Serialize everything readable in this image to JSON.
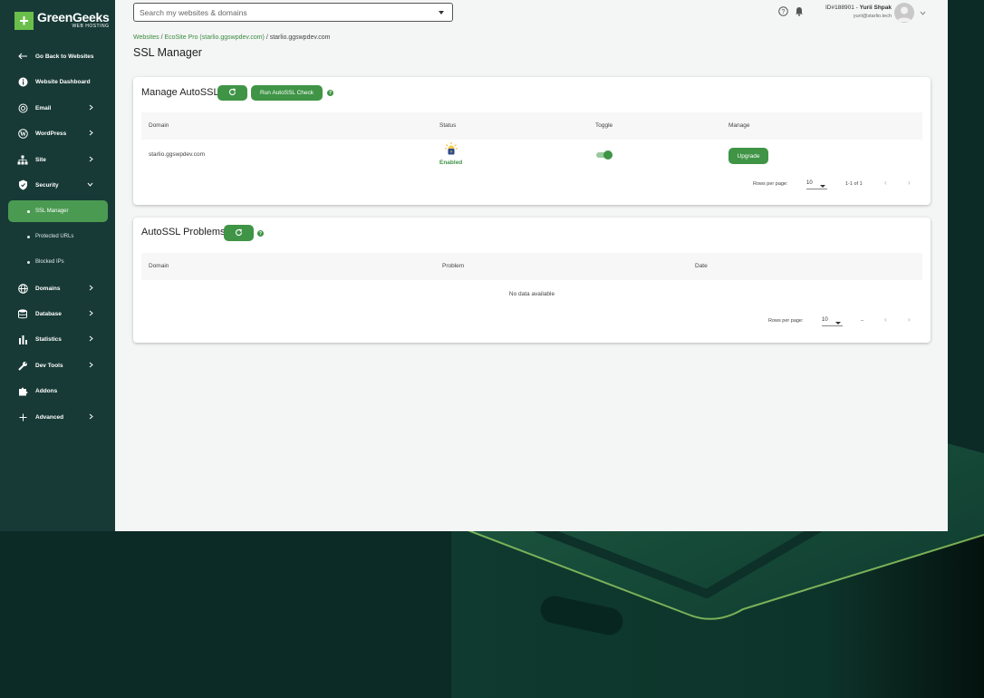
{
  "brand": {
    "name": "GreenGeeks",
    "sub": "WEB HOSTING",
    "mark": "+"
  },
  "search": {
    "placeholder": "Search my websites & domains"
  },
  "user": {
    "id_prefix": "ID#188901 - ",
    "name": "Yurii Shpak",
    "email": "yurii@starlio.tech"
  },
  "sidebar": {
    "items": [
      {
        "label": "Go Back to Websites",
        "icon": "arrow-left-icon"
      },
      {
        "label": "Website Dashboard",
        "icon": "info-icon"
      },
      {
        "label": "Email",
        "icon": "at-icon",
        "expandable": true
      },
      {
        "label": "WordPress",
        "icon": "wordpress-icon",
        "expandable": true
      },
      {
        "label": "Site",
        "icon": "sitemap-icon",
        "expandable": true
      },
      {
        "label": "Security",
        "icon": "shield-icon",
        "expanded": true
      },
      {
        "label": "Domains",
        "icon": "globe-icon",
        "expandable": true
      },
      {
        "label": "Database",
        "icon": "database-icon",
        "expandable": true
      },
      {
        "label": "Statistics",
        "icon": "bar-chart-icon",
        "expandable": true
      },
      {
        "label": "Dev Tools",
        "icon": "wrench-icon",
        "expandable": true
      },
      {
        "label": "Addons",
        "icon": "puzzle-icon"
      },
      {
        "label": "Advanced",
        "icon": "plus-icon",
        "expandable": true
      }
    ],
    "security_sub": [
      "SSL Manager",
      "Protected URLs",
      "Blocked IPs"
    ]
  },
  "breadcrumb": {
    "websites": "Websites",
    "sep": " / ",
    "plan": "EcoSite Pro (starlio.ggswpdev.com)",
    "current": "starlio.ggswpdev.com"
  },
  "page_title": "SSL Manager",
  "manage_autossl": {
    "title": "Manage AutoSSL",
    "run_check": "Run AutoSSL Check",
    "help": "?",
    "columns": [
      "Domain",
      "Status",
      "Toggle",
      "Manage"
    ],
    "rows": [
      {
        "domain": "starlio.ggswpdev.com",
        "status": "Enabled",
        "toggle_on": true,
        "manage": "Upgrade"
      }
    ],
    "pager": {
      "rows_label": "Rows per page:",
      "rows_value": "10",
      "range": "1-1 of 1"
    }
  },
  "autossl_problems": {
    "title": "AutoSSL Problems",
    "help": "?",
    "columns": [
      "Domain",
      "Problem",
      "Date"
    ],
    "empty": "No data available",
    "pager": {
      "rows_label": "Rows per page:",
      "rows_value": "10",
      "range": "–"
    }
  },
  "colors": {
    "accent": "#3f9446",
    "sidebar": "#173a36",
    "background": "#0c2a26"
  }
}
